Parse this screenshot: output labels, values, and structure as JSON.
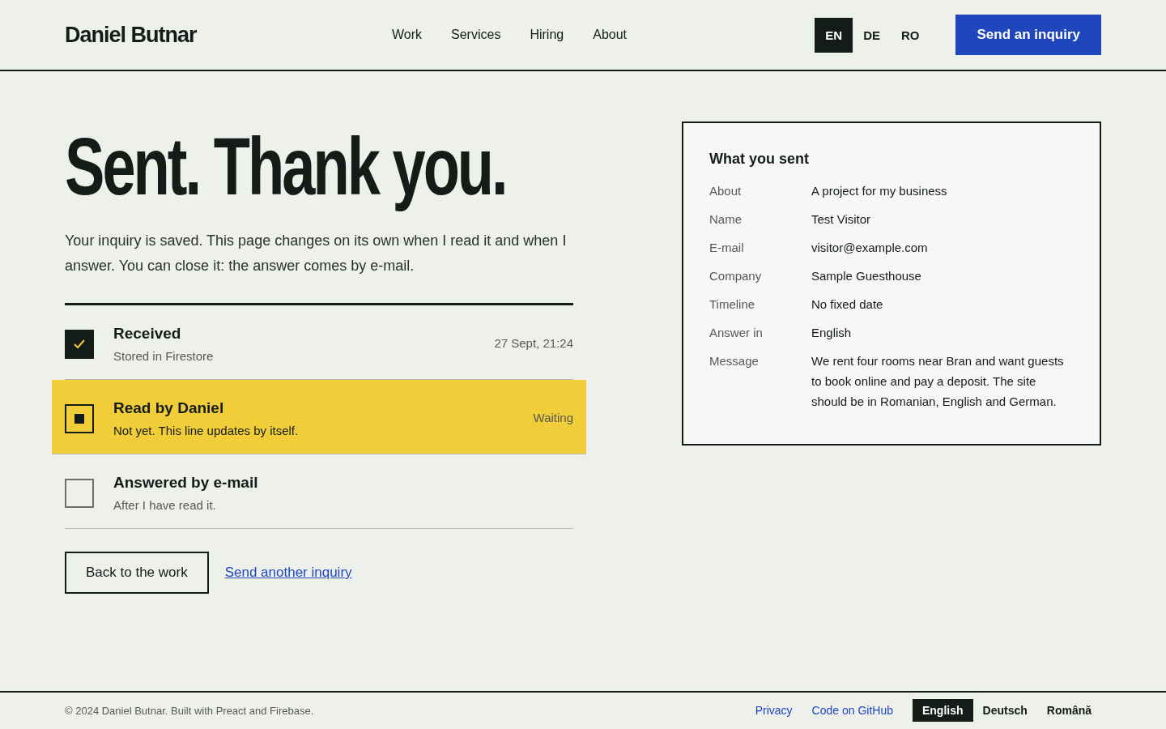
{
  "header": {
    "logo": "Daniel Butnar",
    "nav": [
      {
        "label": "Work",
        "selected": false
      },
      {
        "label": "Services",
        "selected": false
      },
      {
        "label": "Hiring",
        "selected": false
      },
      {
        "label": "About",
        "selected": false
      }
    ],
    "languages": [
      {
        "label": "EN",
        "selected": true
      },
      {
        "label": "DE",
        "selected": false
      },
      {
        "label": "RO",
        "selected": false
      }
    ],
    "cta": "Send an inquiry"
  },
  "main": {
    "title": "Sent. Thank you.",
    "intro": "Your inquiry is saved. This page changes on its own when I read it and when I answer. You can close it: the answer comes by e-mail.",
    "steps": [
      {
        "kind": "done",
        "title": "Received",
        "note": "Stored in Firestore",
        "time": "27 Sept, 21:24"
      },
      {
        "kind": "current",
        "title": "Read by Daniel",
        "note": "Not yet. This line updates by itself.",
        "time": "Waiting"
      },
      {
        "kind": "pending",
        "title": "Answered by e-mail",
        "note": "After I have read it."
      }
    ],
    "back_button": "Back to the work",
    "another_link": "Send another inquiry"
  },
  "summary": {
    "title": "What you sent",
    "rows": [
      {
        "label": "About",
        "value": "A project for my business"
      },
      {
        "label": "Name",
        "value": "Test Visitor"
      },
      {
        "label": "E-mail",
        "value": "visitor@example.com"
      },
      {
        "label": "Company",
        "value": "Sample Guesthouse"
      },
      {
        "label": "Timeline",
        "value": "No fixed date"
      },
      {
        "label": "Answer in",
        "value": "English"
      },
      {
        "label": "Message",
        "value": "We rent four rooms near Bran and want guests to book online and pay a deposit. The site should be in Romanian, English and German."
      }
    ]
  },
  "footer": {
    "copyright": "© 2024 Daniel Butnar. Built with Preact and Firebase.",
    "links": [
      "Privacy",
      "Code on GitHub"
    ],
    "languages": [
      {
        "label": "English",
        "selected": true
      },
      {
        "label": "Deutsch",
        "selected": false
      },
      {
        "label": "Română",
        "selected": false
      }
    ]
  }
}
